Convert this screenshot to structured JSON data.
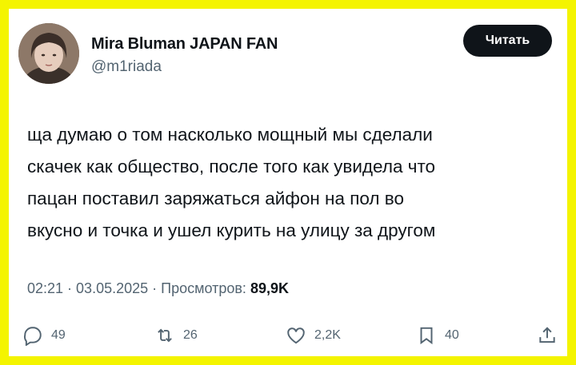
{
  "author": {
    "display_name": "Mira Bluman JAPAN FAN",
    "handle": "@m1riada"
  },
  "follow_button": {
    "label": "Читать"
  },
  "tweet": {
    "lines": [
      "ща думаю о том насколько мощный мы сделали",
      "скачек как общество, после того как увидела что",
      "пацан поставил заряжаться айфон на пол во",
      "вкусно и точка и ушел курить на улицу за другом"
    ]
  },
  "meta": {
    "time": "02:21",
    "separator": " · ",
    "date": "03.05.2025",
    "views_label": "Просмотров:",
    "views_count": "89,9K"
  },
  "actions": {
    "replies": {
      "icon": "reply-icon",
      "count": "49"
    },
    "retweets": {
      "icon": "retweet-icon",
      "count": "26"
    },
    "likes": {
      "icon": "heart-icon",
      "count": "2,2K"
    },
    "bookmarks": {
      "icon": "bookmark-icon",
      "count": "40"
    },
    "share": {
      "icon": "share-icon"
    }
  },
  "colors": {
    "frame": "#f4f400",
    "text_primary": "#0f1419",
    "text_secondary": "#536471",
    "button_bg": "#0f1419"
  }
}
